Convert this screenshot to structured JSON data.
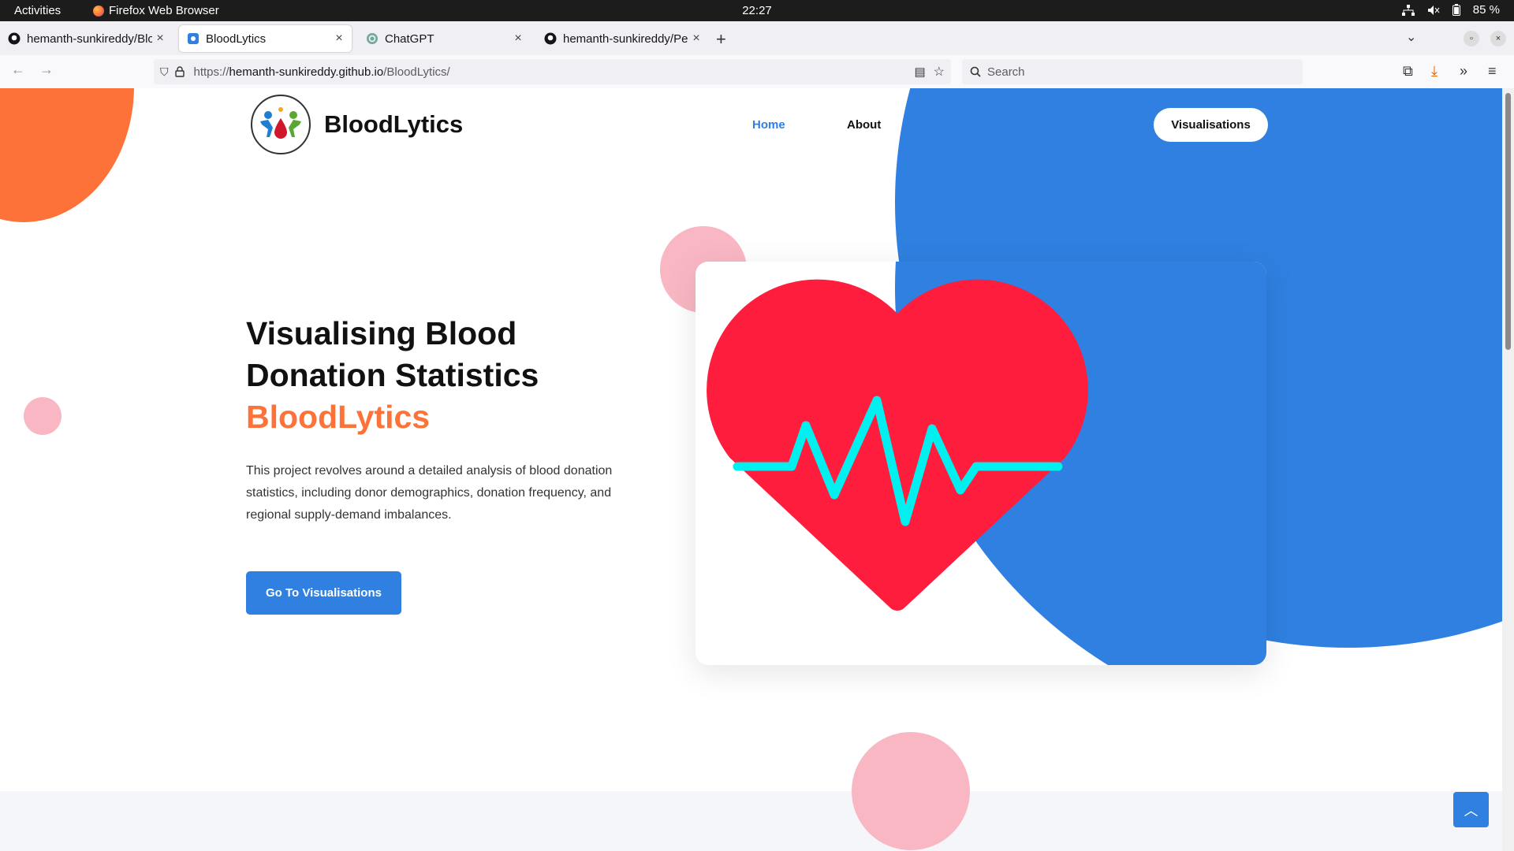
{
  "system": {
    "activities": "Activities",
    "app_name": "Firefox Web Browser",
    "clock": "22:27",
    "battery": "85 %"
  },
  "tabs": [
    {
      "label": "hemanth-sunkireddy/Blo",
      "favicon": "github-icon"
    },
    {
      "label": "BloodLytics",
      "favicon": "site-icon"
    },
    {
      "label": "ChatGPT",
      "favicon": "chatgpt-icon"
    },
    {
      "label": "hemanth-sunkireddy/Per",
      "favicon": "github-icon"
    }
  ],
  "address_bar": {
    "scheme": "https://",
    "host": "hemanth-sunkireddy.github.io",
    "path": "/BloodLytics/"
  },
  "search_bar": {
    "placeholder": "Search"
  },
  "site": {
    "brand": "BloodLytics",
    "nav": {
      "home": "Home",
      "about": "About"
    },
    "nav_button": "Visualisations",
    "hero": {
      "title": "Visualising Blood Donation Statistics",
      "brand_line": "BloodLytics",
      "description": "This project revolves around a detailed analysis of blood donation statistics, including donor demographics, donation frequency, and regional supply-demand imbalances.",
      "cta": "Go To Visualisations"
    }
  },
  "colors": {
    "accent_blue": "#2f80e0",
    "accent_orange": "#fd7238",
    "heart_red": "#ff1d3d",
    "pulse_cyan": "#00f0f0",
    "bubble_pink": "#f9b7c3"
  }
}
